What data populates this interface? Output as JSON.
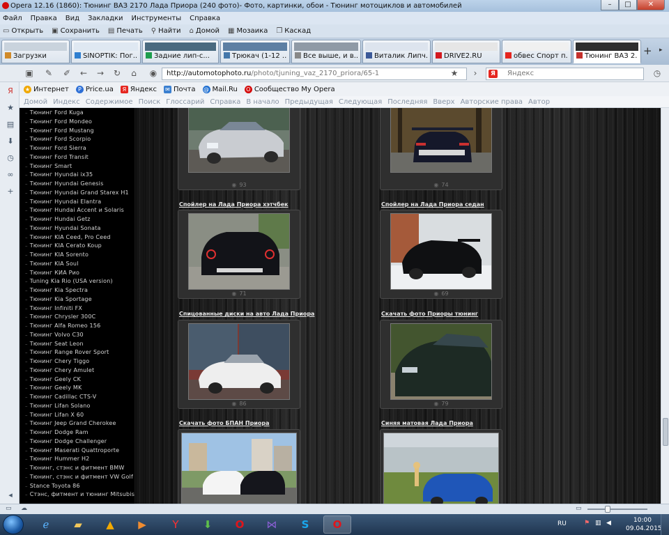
{
  "window": {
    "title": "Opera 12.16 (1860): Тюнинг ВАЗ 2170 Лада Приора (240 фото)- Фото, картинки, обои - Тюнинг мотоциклов и автомобилей",
    "minimize": "–",
    "maximize": "□",
    "close": "✕"
  },
  "menu": [
    "Файл",
    "Правка",
    "Вид",
    "Закладки",
    "Инструменты",
    "Справка"
  ],
  "toolbar": [
    {
      "icon": "folder-icon",
      "label": "Открыть"
    },
    {
      "icon": "save-icon",
      "label": "Сохранить"
    },
    {
      "icon": "print-icon",
      "label": "Печать"
    },
    {
      "icon": "find-icon",
      "label": "Найти"
    },
    {
      "icon": "home-icon",
      "label": "Домой"
    },
    {
      "icon": "mosaic-icon",
      "label": "Мозаика"
    },
    {
      "icon": "cascade-icon",
      "label": "Каскад"
    }
  ],
  "tabs": [
    {
      "label": "Загрузки",
      "color": "#d08a2a"
    },
    {
      "label": "SINOPTIK: Пог...",
      "color": "#2f7fd0"
    },
    {
      "label": "Задние лип-с...",
      "color": "#1e9d4d"
    },
    {
      "label": "Трюкач (1-12 ...",
      "color": "#4477aa"
    },
    {
      "label": "Все выше, и в...",
      "color": "#888888"
    },
    {
      "label": "Виталик Липч...",
      "color": "#3b5998"
    },
    {
      "label": "DRIVE2.RU",
      "color": "#d3191f"
    },
    {
      "label": "обвес Спорт п...",
      "color": "#e52620"
    },
    {
      "label": "Тюнинг ВАЗ 2...",
      "color": "#c4302b"
    }
  ],
  "address": {
    "url_host": "http://automotophoto.ru",
    "url_path": "/photo/tjuning_vaz_2170_priora/65-1",
    "search_placeholder": "Яндекс",
    "search_badge": "Я"
  },
  "bookmarks": [
    {
      "label": "Интернет",
      "color": "#f0a800"
    },
    {
      "label": "Price.ua",
      "color": "#2d6fd6"
    },
    {
      "label": "Яндекс",
      "color": "#e52620"
    },
    {
      "label": "Почта",
      "color": "#3a7fd0"
    },
    {
      "label": "Mail.Ru",
      "color": "#1c6dd0"
    },
    {
      "label": "Сообщество My Opera",
      "color": "#d40a0a"
    }
  ],
  "site_nav": [
    "Домой",
    "Индекс",
    "Содержимое",
    "Поиск",
    "Глоссарий",
    "Справка",
    "В начало",
    "Предыдущая",
    "Следующая",
    "Последняя",
    "Вверх",
    "Авторские права",
    "Автор"
  ],
  "side_menu": [
    "Тюнинг Ford Kuga",
    "Тюнинг Ford Mondeo",
    "Тюнинг Ford Mustang",
    "Тюнинг Ford Scorpio",
    "Тюнинг Ford Sierra",
    "Тюнинг Ford Transit",
    "Тюнинг Smart",
    "Тюнинг Hyundai ix35",
    "Тюнинг Hyundai Genesis",
    "Тюнинг Hyundai Grand Starex H1",
    "Тюнинг Hyundai Elantra",
    "Тюнинг Hundai Accent и Solaris",
    "Тюнинг Hundai Getz",
    "Тюнинг Hyundai Sonata",
    "Тюнинг KIA Ceed, Pro Ceed",
    "Тюнинг KIA Cerato Koup",
    "Тюнинг KIA Sorento",
    "Тюнинг KIA Soul",
    "Тюнинг КИА Рио",
    "Tuning Kia Rio (USA version)",
    "Тюнинг Kia Spectra",
    "Тюнинг Kia Sportage",
    "Тюнинг Infiniti FX",
    "Тюнинг Chrysler 300C",
    "Тюнинг Alfa Romeo 156",
    "Тюнинг Volvo C30",
    "Тюнинг Seat Leon",
    "Тюнинг Range Rover Sport",
    "Тюнинг Chery Tiggo",
    "Тюнинг Chery Amulet",
    "Тюнинг Geely CK",
    "Тюнинг Geely MK",
    "Тюнинг Cadillac CTS-V",
    "Тюнинг Lifan Solano",
    "Тюнинг Lifan X 60",
    "Тюнинг Jeep Grand Cherokee",
    "Тюнинг Dodge Ram",
    "Тюнинг Dodge Challenger",
    "Тюнинг Maserati Quattroporte",
    "Тюнинг Hummer H2",
    "Тюнинг, стэнс и фитмент BMW",
    "Тюнинг, стэнс и фитмент VW Golf",
    "Stance Toyota 86",
    "Стэнс, фитмент и тюнинг Mitsubishi Lancer"
  ],
  "gallery": [
    {
      "title": "",
      "views": "93",
      "watermark": "AUTOMOTOPHOTO.RU"
    },
    {
      "title": "",
      "views": "74",
      "watermark": "AUTOMOTOPHOTO.RU"
    },
    {
      "title": "Спойлер на Лада Приора хэтчбек",
      "views": "71",
      "watermark": ""
    },
    {
      "title": "Спойлер на Лада Приора седан",
      "views": "69",
      "watermark": "AUTOMOTOPHOTO.RU"
    },
    {
      "title": "Спицованные диски на авто Лада Приора",
      "views": "86",
      "watermark": "AUTOMOTOPHOTO.RU"
    },
    {
      "title": "Скачать фото Приоры тюнинг",
      "views": "79",
      "watermark": ""
    },
    {
      "title": "Скачать фото БПАН Приора",
      "views": "",
      "watermark": ""
    },
    {
      "title": "Синяя матовая Лада Приора",
      "views": "",
      "watermark": ""
    }
  ],
  "taskbar": {
    "lang": "RU",
    "time": "10:00",
    "date": "09.04.2015"
  }
}
